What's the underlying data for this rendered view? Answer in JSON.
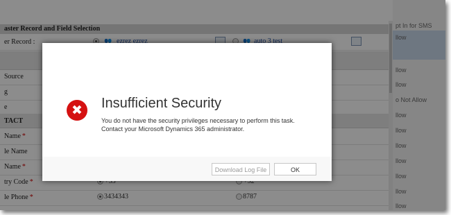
{
  "merge": {
    "section_title": "aster Record and Field Selection",
    "master_label": "er Record :",
    "record1": "ezrez ezrez",
    "record2": "auto 3 test",
    "rows": [
      {
        "label": "Source"
      },
      {
        "label": "g"
      },
      {
        "label": "e"
      }
    ],
    "contact_section": "TACT",
    "contact_rows": [
      {
        "label": "Name",
        "required": true
      },
      {
        "label": "le Name",
        "required": false
      },
      {
        "label": "Name",
        "required": true
      },
      {
        "label": "try Code",
        "required": true,
        "value1": "+33",
        "value2": "+32"
      },
      {
        "label": "le Phone",
        "required": true,
        "value1": "3434343",
        "value2": "8787"
      }
    ],
    "required_mark": "*"
  },
  "right_panel": {
    "items": [
      "pt In for SMS",
      "llow",
      "llow",
      "llow",
      "o Not Allow",
      "llow",
      "llow",
      "llow",
      "llow",
      "llow",
      "llow",
      "llow"
    ]
  },
  "dialog": {
    "title": "Insufficient Security",
    "message": "You do not have the security privileges necessary to perform this task. Contact your Microsoft Dynamics 365 administrator.",
    "download_log_label": "Download Log File",
    "ok_label": "OK",
    "error_icon_glyph": "✖",
    "error_color": "#d51111"
  }
}
